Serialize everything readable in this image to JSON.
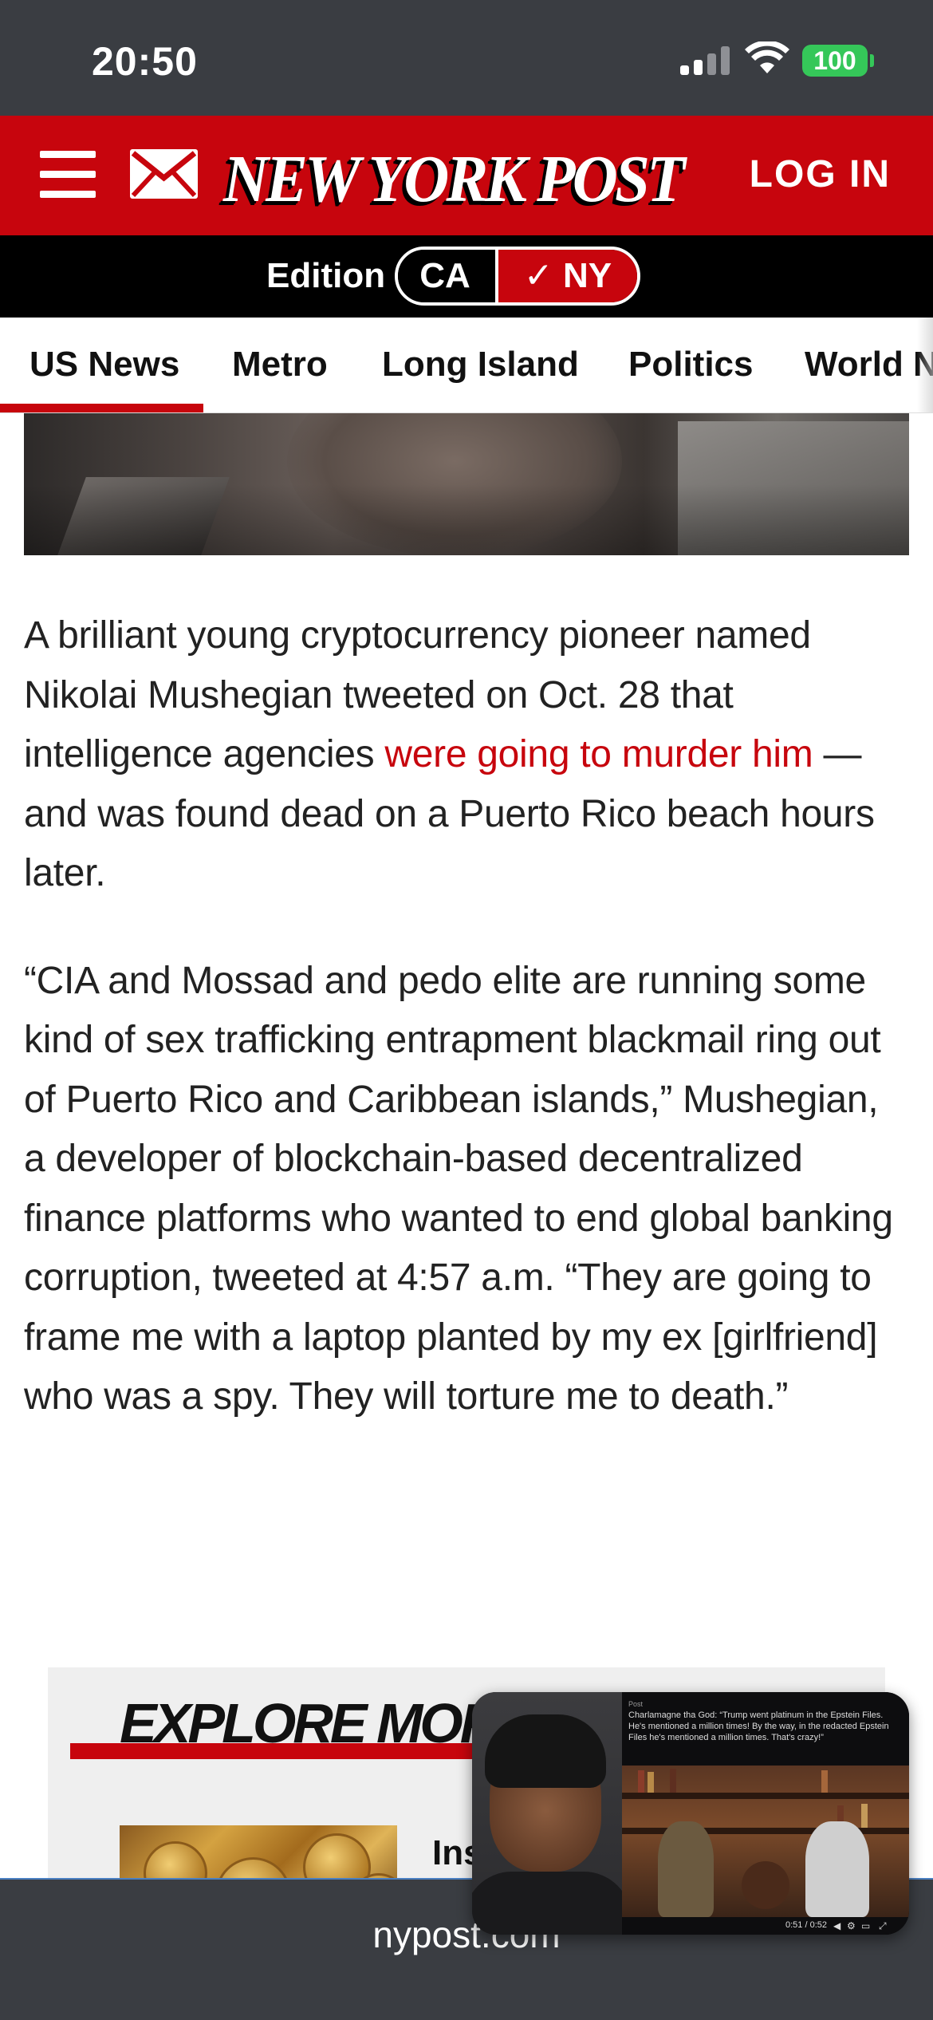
{
  "status_bar": {
    "time": "20:50",
    "battery": "100",
    "battery_color": "#35c759"
  },
  "header": {
    "logo": "NEW YORK POST",
    "login_label": "LOG IN",
    "menu_icon": "hamburger-menu-icon",
    "mail_icon": "mail-icon",
    "brand_color": "#c7050d"
  },
  "edition": {
    "label": "Edition",
    "options": [
      "CA",
      "NY"
    ],
    "selected": "NY",
    "selected_check": "✓"
  },
  "sections": {
    "items": [
      "US News",
      "Metro",
      "Long Island",
      "Politics",
      "World N"
    ],
    "active": "US News"
  },
  "article": {
    "para1_before_link": "A brilliant young cryptocurrency pioneer named Nikolai Mushegian tweeted on Oct. 28 that intelligence agencies ",
    "para1_link": "were going to murder him",
    "para1_after_link": " — and was found dead on a Puerto Rico beach hours later.",
    "para2": "“CIA and Mossad and pedo elite are running some kind of sex trafficking entrapment blackmail ring out of Puerto Rico and Caribbean islands,” Mushegian, a developer of blockchain-based decentralized finance platforms who wanted to end global banking corruption, tweeted at 4:57 a.m. “They are going to frame me with a laptop planted by my ex [girlfriend] who was a spy. They will torture me to death.”"
  },
  "explore": {
    "title": "EXPLORE MORE",
    "headline_partial": "Ins"
  },
  "pip_video": {
    "source": "Post",
    "caption": "Charlamagne tha God: “Trump went platinum in the Epstein Files. He's mentioned a million times! By the way, in the redacted Epstein Files he's mentioned a million times. That's crazy!”",
    "time": "0:51 / 0:52"
  },
  "browser": {
    "url": "nypost.com"
  }
}
